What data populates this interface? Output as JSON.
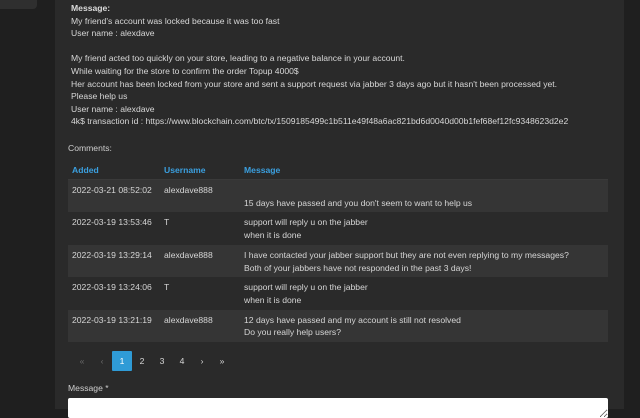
{
  "message": {
    "title": "Message:",
    "lines": [
      "My friend's account was locked because it was too fast",
      "User name : alexdave",
      "",
      "My friend acted too quickly on your store, leading to a negative balance in your account.",
      "While waiting for the store to confirm the order Topup 4000$",
      "Her account has been locked from your store and sent a support request via jabber 3 days ago but it hasn't been processed yet.",
      "Please help us",
      "User name : alexdave",
      "4k$ transaction id : https://www.blockchain.com/btc/tx/1509185499c1b511e49f48a6ac821bd6d0040d00b1fef68ef12fc9348623d2e2"
    ]
  },
  "comments": {
    "label": "Comments:",
    "columns": [
      "Added",
      "Username",
      "Message"
    ],
    "rows": [
      {
        "added": "2022-03-21 08:52:02",
        "username": "alexdave888",
        "message": [
          "",
          "15 days have passed and you don't seem to want to help us"
        ]
      },
      {
        "added": "2022-03-19 13:53:46",
        "username": "T",
        "message": [
          "support will reply u on the jabber",
          "when it is done"
        ]
      },
      {
        "added": "2022-03-19 13:29:14",
        "username": "alexdave888",
        "message": [
          "I have contacted your jabber support but they are not even replying to my messages?",
          "Both of your jabbers have not responded in the past 3 days!"
        ]
      },
      {
        "added": "2022-03-19 13:24:06",
        "username": "T",
        "message": [
          "support will reply u on the jabber",
          "when it is done"
        ]
      },
      {
        "added": "2022-03-19 13:21:19",
        "username": "alexdave888",
        "message": [
          "12 days have passed and my account is still not resolved",
          "Do you really help users?"
        ]
      }
    ]
  },
  "pagination": {
    "first": "«",
    "prev": "‹",
    "pages": [
      "1",
      "2",
      "3",
      "4"
    ],
    "active_page": "1",
    "next": "›",
    "last": "»"
  },
  "form": {
    "message_label": "Message *",
    "message_value": ""
  }
}
